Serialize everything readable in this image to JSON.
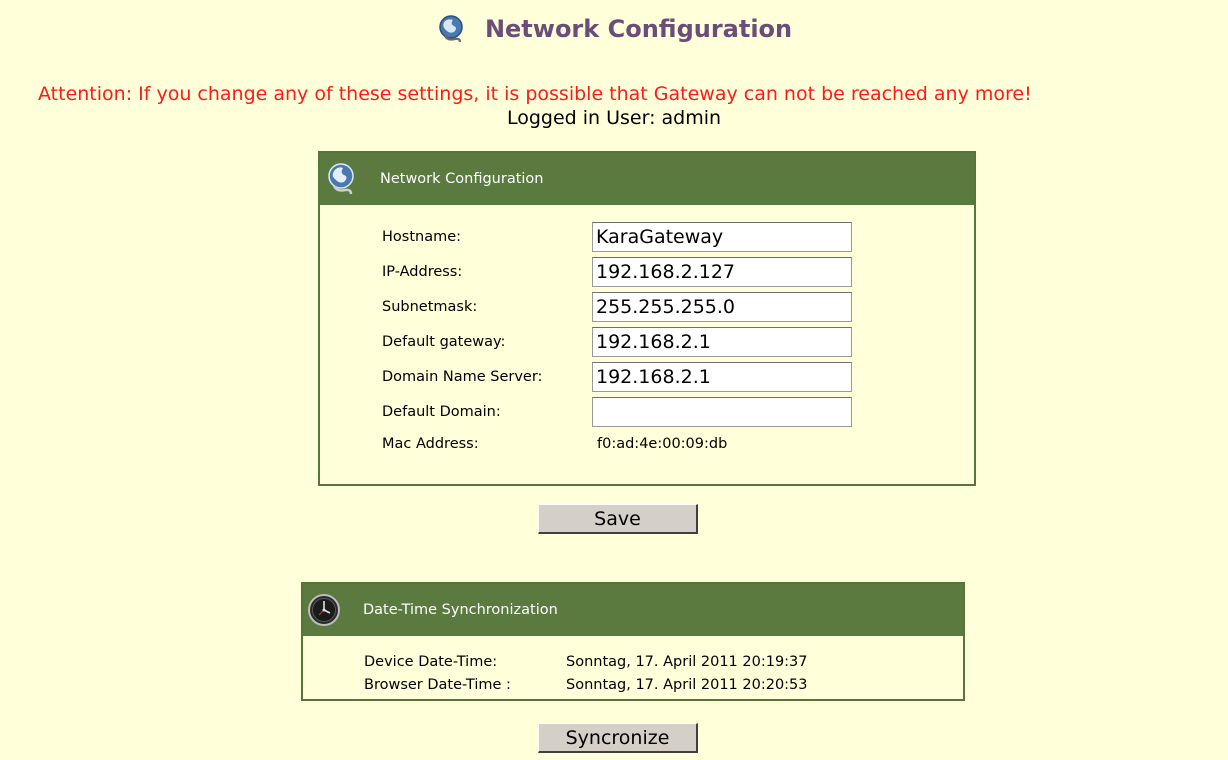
{
  "header": {
    "title": "Network Configuration",
    "icon": "globe-network-icon"
  },
  "attention": "Attention: If you change any of these settings, it is possible that Gateway can not be reached any more!",
  "logged_in": "Logged in User: admin",
  "network_panel": {
    "title": "Network Configuration",
    "icon": "globe-network-icon",
    "fields": [
      {
        "label": "Hostname:",
        "value": "KaraGateway"
      },
      {
        "label": "IP-Address:",
        "value": "192.168.2.127"
      },
      {
        "label": "Subnetmask:",
        "value": "255.255.255.0"
      },
      {
        "label": "Default gateway:",
        "value": "192.168.2.1"
      },
      {
        "label": "Domain Name Server:",
        "value": "192.168.2.1"
      },
      {
        "label": "Default Domain:",
        "value": ""
      }
    ],
    "mac": {
      "label": "Mac Address:",
      "value": "f0:ad:4e:00:09:db"
    }
  },
  "save_label": "Save",
  "datetime_panel": {
    "title": "Date-Time Synchronization",
    "icon": "clock-icon",
    "device_label": "Device Date-Time:",
    "device_value": "Sonntag, 17. April 2011 20:19:37",
    "browser_label": "Browser Date-Time :",
    "browser_value": "Sonntag, 17. April 2011 20:20:53"
  },
  "sync_label": "Syncronize",
  "colors": {
    "background": "#ffffd9",
    "panel_header": "#5a7a40",
    "title": "#6b4c7a",
    "attention": "#ff1a1a"
  }
}
